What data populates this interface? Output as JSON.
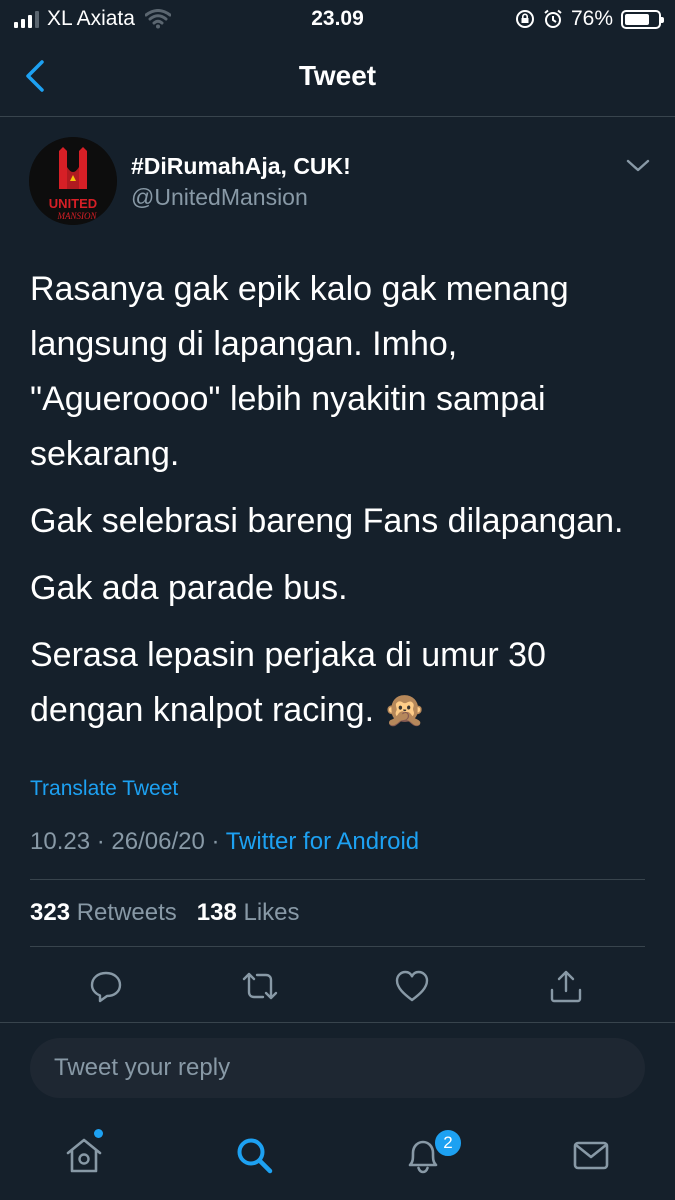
{
  "status_bar": {
    "carrier": "XL Axiata",
    "time": "23.09",
    "battery": "76%",
    "battery_level": 0.76
  },
  "header": {
    "title": "Tweet"
  },
  "tweet": {
    "author_name": "#DiRumahAja, CUK!",
    "author_handle": "@UnitedMansion",
    "avatar": {
      "logo_text_top": "UNITED",
      "logo_text_bottom": "MANSION"
    },
    "paragraphs": [
      "Rasanya gak epik kalo gak menang langsung di lapangan. Imho, \"Agueroooo\" lebih nyakitin sampai sekarang.",
      "Gak selebrasi bareng Fans dilapangan.",
      "Gak ada parade bus.",
      "Serasa lepasin perjaka di umur 30 dengan knalpot racing. 🙊"
    ],
    "translate_label": "Translate Tweet",
    "timestamp": "10.23 · 26/06/20 · ",
    "source": "Twitter for Android",
    "retweets_count": "323",
    "retweets_label": "Retweets",
    "likes_count": "138",
    "likes_label": "Likes"
  },
  "reply": {
    "placeholder": "Tweet your reply"
  },
  "tabbar": {
    "notifications_badge": "2"
  },
  "colors": {
    "background": "#15202b",
    "accent": "#1da1f2",
    "secondary_text": "#8899a6",
    "divider": "#38444d"
  }
}
